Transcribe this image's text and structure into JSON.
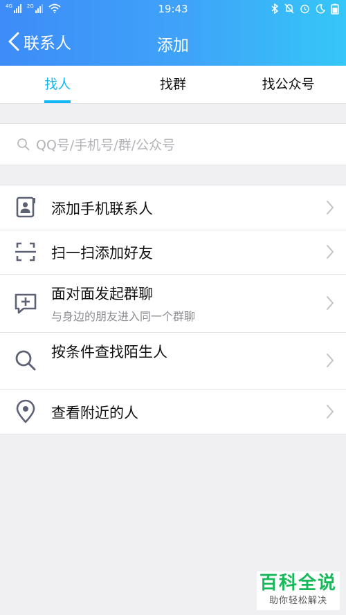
{
  "status_bar": {
    "sim1": "4G",
    "sim2": "2G",
    "time": "19:43"
  },
  "navbar": {
    "back_label": "联系人",
    "title": "添加"
  },
  "tabs": [
    {
      "label": "找人",
      "active": true
    },
    {
      "label": "找群",
      "active": false
    },
    {
      "label": "找公众号",
      "active": false
    }
  ],
  "search": {
    "placeholder": "QQ号/手机号/群/公众号"
  },
  "menu": [
    {
      "title": "添加手机联系人",
      "icon": "contact-card-icon"
    },
    {
      "title": "扫一扫添加好友",
      "icon": "scan-icon"
    },
    {
      "title": "面对面发起群聊",
      "subtitle": "与身边的朋友进入同一个群聊",
      "icon": "chat-add-icon"
    },
    {
      "title": "按条件查找陌生人",
      "icon": "search-icon"
    },
    {
      "title": "查看附近的人",
      "icon": "location-pin-icon"
    }
  ],
  "watermark": {
    "main": "百科全说",
    "sub": "助你轻松解决"
  },
  "colors": {
    "accent": "#12b7f5",
    "header_start": "#3d8cf8",
    "header_end": "#35c7f7",
    "watermark_green": "#17b85a"
  }
}
